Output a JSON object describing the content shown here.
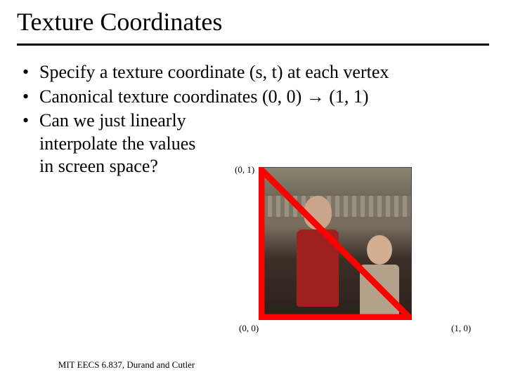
{
  "title": "Texture Coordinates",
  "bullets": [
    "Specify a texture coordinate (s, t) at each vertex",
    "Canonical texture coordinates (0, 0) → (1, 1)",
    "Can we just linearly\ninterpolate the values\nin screen space?"
  ],
  "figure": {
    "labels": {
      "top_left": "(0, 1)",
      "bottom_left": "(0, 0)",
      "bottom_right": "(1, 0)"
    },
    "triangle_color": "#ff0000"
  },
  "footer": "MIT EECS 6.837, Durand and Cutler"
}
